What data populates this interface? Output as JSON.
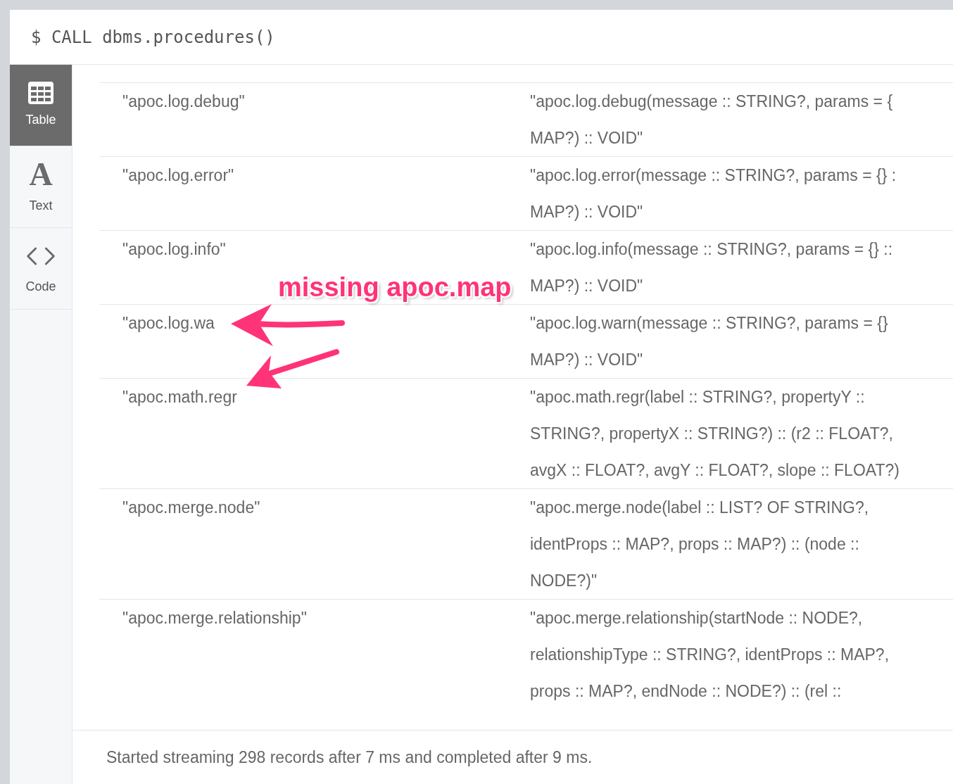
{
  "command": {
    "prompt": "$",
    "query": "CALL dbms.procedures()"
  },
  "view_tabs": [
    {
      "kind": "grid",
      "label": "Table",
      "selected": true
    },
    {
      "kind": "glyph",
      "glyph": "A",
      "label": "Text",
      "selected": false
    },
    {
      "kind": "code",
      "label": "Code",
      "selected": false
    }
  ],
  "rows": [
    {
      "name": "\"apoc.log.debug\"",
      "signature": [
        "\"apoc.log.debug(message :: STRING?, params = {",
        "MAP?) :: VOID\""
      ]
    },
    {
      "name": "\"apoc.log.error\"",
      "signature": [
        "\"apoc.log.error(message :: STRING?, params = {} :",
        "MAP?) :: VOID\""
      ]
    },
    {
      "name": "\"apoc.log.info\"",
      "signature": [
        "\"apoc.log.info(message :: STRING?, params = {} ::",
        "MAP?) :: VOID\""
      ]
    },
    {
      "name": "\"apoc.log.wa",
      "signature": [
        "\"apoc.log.warn(message :: STRING?, params = {}",
        "MAP?) :: VOID\""
      ]
    },
    {
      "name": "\"apoc.math.regr",
      "signature": [
        "\"apoc.math.regr(label :: STRING?, propertyY ::",
        "STRING?, propertyX :: STRING?) :: (r2 :: FLOAT?,",
        "avgX :: FLOAT?, avgY :: FLOAT?, slope :: FLOAT?)"
      ]
    },
    {
      "name": "\"apoc.merge.node\"",
      "signature": [
        "\"apoc.merge.node(label :: LIST? OF STRING?,",
        "identProps :: MAP?, props :: MAP?) :: (node ::",
        "NODE?)\""
      ]
    },
    {
      "name": "\"apoc.merge.relationship\"",
      "signature": [
        "\"apoc.merge.relationship(startNode :: NODE?,",
        "relationshipType :: STRING?, identProps :: MAP?,",
        "props :: MAP?, endNode :: NODE?) :: (rel ::"
      ]
    }
  ],
  "status": "Started streaming 298 records after 7 ms and completed after 9 ms.",
  "annotation": {
    "label": "missing apoc.map"
  }
}
